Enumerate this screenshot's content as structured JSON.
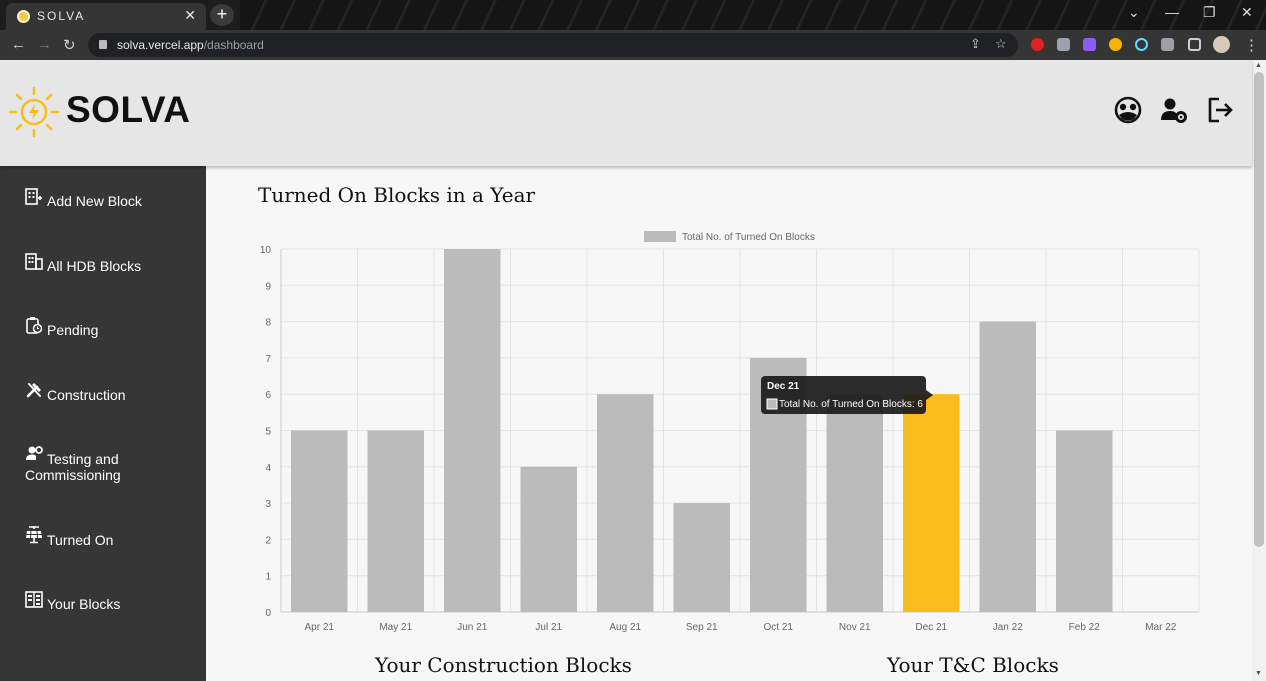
{
  "browser": {
    "tab_title": "SOLVA",
    "url_host": "solva.vercel.app",
    "url_path": "/dashboard"
  },
  "app": {
    "logo_text": "SOLVA",
    "header_icons": [
      "analytics-icon",
      "user-settings-icon",
      "logout-icon"
    ]
  },
  "sidebar": {
    "items": [
      {
        "label": "Add New Block",
        "icon": "building-add-icon"
      },
      {
        "label": "All HDB Blocks",
        "icon": "building-icon"
      },
      {
        "label": "Pending",
        "icon": "clipboard-clock-icon"
      },
      {
        "label": "Construction",
        "icon": "tools-icon"
      },
      {
        "label": "Testing and Commissioning",
        "icon": "user-gear-icon"
      },
      {
        "label": "Turned On",
        "icon": "solar-panel-icon"
      },
      {
        "label": "Your Blocks",
        "icon": "list-building-icon"
      }
    ]
  },
  "main": {
    "title": "Turned On Blocks in a Year",
    "section_left": "Your Construction Blocks",
    "section_right": "Your T&C Blocks"
  },
  "chart_data": {
    "type": "bar",
    "categories": [
      "Apr 21",
      "May 21",
      "Jun 21",
      "Jul 21",
      "Aug 21",
      "Sep 21",
      "Oct 21",
      "Nov 21",
      "Dec 21",
      "Jan 22",
      "Feb 22",
      "Mar 22"
    ],
    "series": [
      {
        "name": "Total No. of Turned On Blocks",
        "values": [
          5,
          5,
          10,
          4,
          6,
          3,
          7,
          6,
          6,
          8,
          5,
          0
        ]
      }
    ],
    "ylim": [
      0,
      10
    ],
    "yticks": [
      "0",
      "1",
      "2",
      "3",
      "4",
      "5",
      "6",
      "7",
      "8",
      "9",
      "10"
    ],
    "grid": true,
    "legend": "top-center",
    "bar_color": "#bbbbbb",
    "highlight_color": "#f8bc1c",
    "highlighted_category": "Dec 21",
    "tooltip": {
      "title": "Dec 21",
      "body": "Total No. of Turned On Blocks: 6"
    }
  }
}
